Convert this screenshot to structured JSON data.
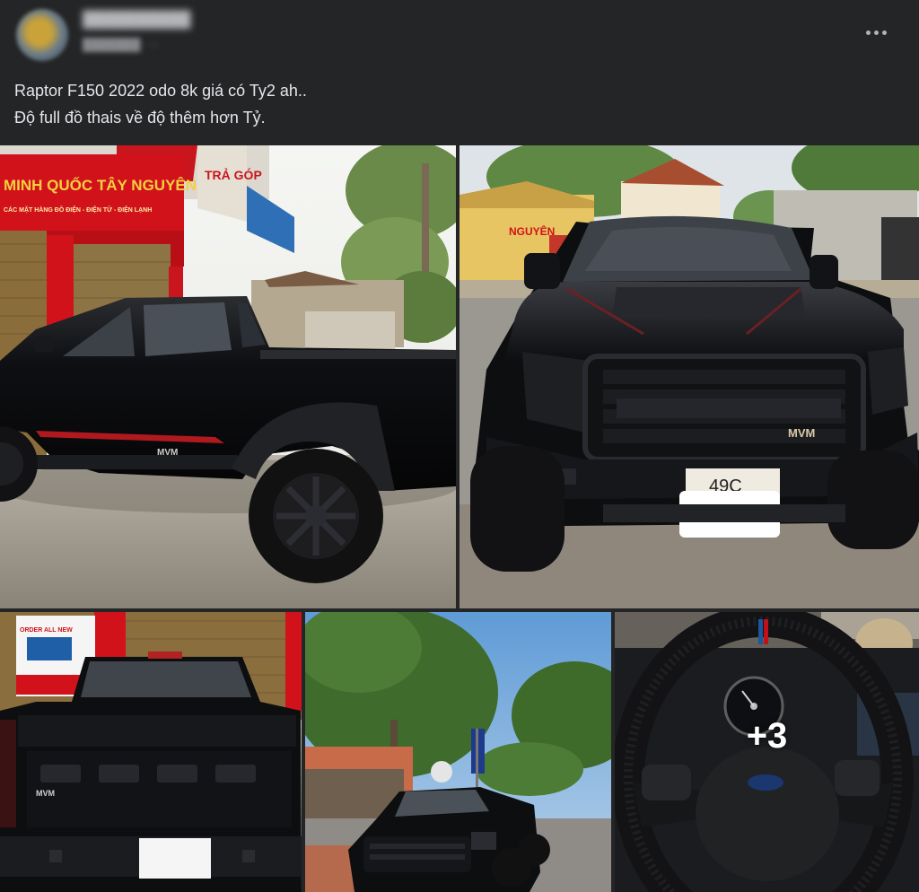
{
  "post": {
    "caption_lines": [
      "Raptor F150 2022 odo 8k giá có Ty2 ah..",
      "Độ full đồ thais về độ thêm hơn Tỷ."
    ],
    "more_icon": "ellipsis-icon"
  },
  "photos": {
    "photo1": {
      "shop_sign": "MINH QUỐC TÂY NGUYÊN",
      "shop_sub": "CÁC MẶT HÀNG ĐỒ ĐIỆN - ĐIỆN TỬ - ĐIỆN LẠNH",
      "sign_partial": "TRẢ GÓP",
      "badge": "MVM"
    },
    "photo2": {
      "plate": "49C",
      "badge": "MVM",
      "sign": "NGUYÊN"
    },
    "photo3": {
      "tv_banner": "ORDER ALL NEW",
      "badge": "MVM"
    },
    "photo4": {},
    "photo5": {
      "overlay_count": "+3"
    }
  },
  "colors": {
    "background": "#242526",
    "text_primary": "#e4e6eb",
    "text_secondary": "#b0b3b8",
    "truck_black": "#0d0e10",
    "shop_red": "#d1121b",
    "shop_yellow": "#f4d03f"
  }
}
